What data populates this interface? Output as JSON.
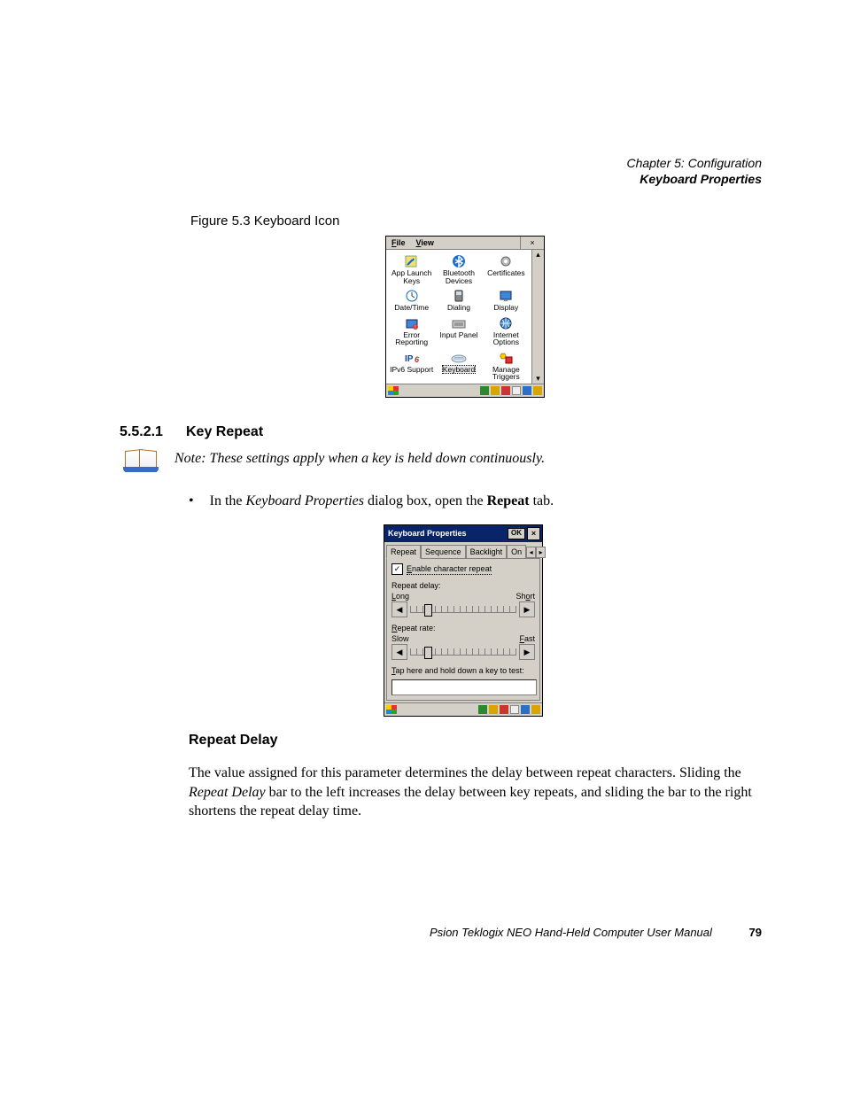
{
  "header": {
    "chapter": "Chapter 5: Configuration",
    "section": "Keyboard Properties"
  },
  "figure1": {
    "caption": "Figure 5.3  Keyboard Icon",
    "menu": {
      "file": "File",
      "view": "View"
    },
    "icons": [
      {
        "label": "App Launch Keys",
        "glyph": "shortcut"
      },
      {
        "label": "Bluetooth Devices",
        "glyph": "bluetooth"
      },
      {
        "label": "Certificates",
        "glyph": "gear"
      },
      {
        "label": "Date/Time",
        "glyph": "clock"
      },
      {
        "label": "Dialing",
        "glyph": "phone"
      },
      {
        "label": "Display",
        "glyph": "monitor"
      },
      {
        "label": "Error Reporting",
        "glyph": "error"
      },
      {
        "label": "Input Panel",
        "glyph": "panel"
      },
      {
        "label": "Internet Options",
        "glyph": "globe"
      },
      {
        "label": "IPv6 Support",
        "glyph": "ipv6"
      },
      {
        "label": "Keyboard",
        "glyph": "keyboard",
        "selected": true
      },
      {
        "label": "Manage Triggers",
        "glyph": "trigger"
      }
    ]
  },
  "section": {
    "number": "5.5.2.1",
    "title": "Key Repeat"
  },
  "note": "Note: These settings apply when a key is held down continuously.",
  "bullet": {
    "pre": "In the ",
    "em": "Keyboard Properties",
    "mid": " dialog box, open the ",
    "strong": "Repeat",
    "post": " tab."
  },
  "figure2": {
    "title": "Keyboard Properties",
    "ok": "OK",
    "tabs": [
      "Repeat",
      "Sequence",
      "Backlight",
      "On"
    ],
    "active_tab": "Repeat",
    "enable_checked": true,
    "enable_label": "Enable character repeat",
    "delay": {
      "label": "Repeat delay:",
      "left": "Long",
      "right": "Short"
    },
    "rate": {
      "label": "Repeat rate:",
      "left": "Slow",
      "right": "Fast"
    },
    "test_label": "Tap here and hold down a key to test:"
  },
  "subhead": "Repeat Delay",
  "para": {
    "t1": "The value assigned for this parameter determines the delay between repeat characters. Sliding the ",
    "em": "Repeat Delay",
    "t2": " bar to the left increases the delay between key repeats, and sliding the bar to the right shortens the repeat delay time."
  },
  "footer": {
    "text": "Psion Teklogix NEO Hand-Held Computer User Manual",
    "page": "79"
  }
}
